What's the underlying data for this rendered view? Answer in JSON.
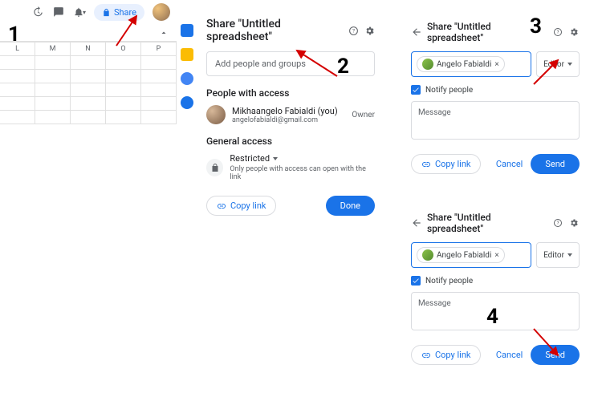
{
  "steps": {
    "s1": "1",
    "s2": "2",
    "s3": "3",
    "s4": "4"
  },
  "toolbar": {
    "share_label": "Share",
    "columns": [
      "L",
      "M",
      "N",
      "O",
      "P"
    ]
  },
  "dlg2": {
    "title": "Share \"Untitled spreadsheet\"",
    "placeholder": "Add people and groups",
    "people_heading": "People with access",
    "person_name": "Mikhaangelo Fabialdi (you)",
    "person_email": "angelofabialdi@gmail.com",
    "owner_label": "Owner",
    "general_heading": "General access",
    "restricted_label": "Restricted",
    "restricted_sub": "Only people with access can open with the link",
    "copy_link": "Copy link",
    "done": "Done"
  },
  "dlg3": {
    "title": "Share \"Untitled spreadsheet\"",
    "chip_name": "Angelo Fabialdi",
    "role": "Editor",
    "notify": "Notify people",
    "message_placeholder": "Message",
    "copy_link": "Copy link",
    "cancel": "Cancel",
    "send": "Send"
  },
  "dlg4": {
    "title": "Share \"Untitled spreadsheet\"",
    "chip_name": "Angelo Fabialdi",
    "role": "Editor",
    "notify": "Notify people",
    "message_placeholder": "Message",
    "copy_link": "Copy link",
    "cancel": "Cancel",
    "send": "Send"
  }
}
